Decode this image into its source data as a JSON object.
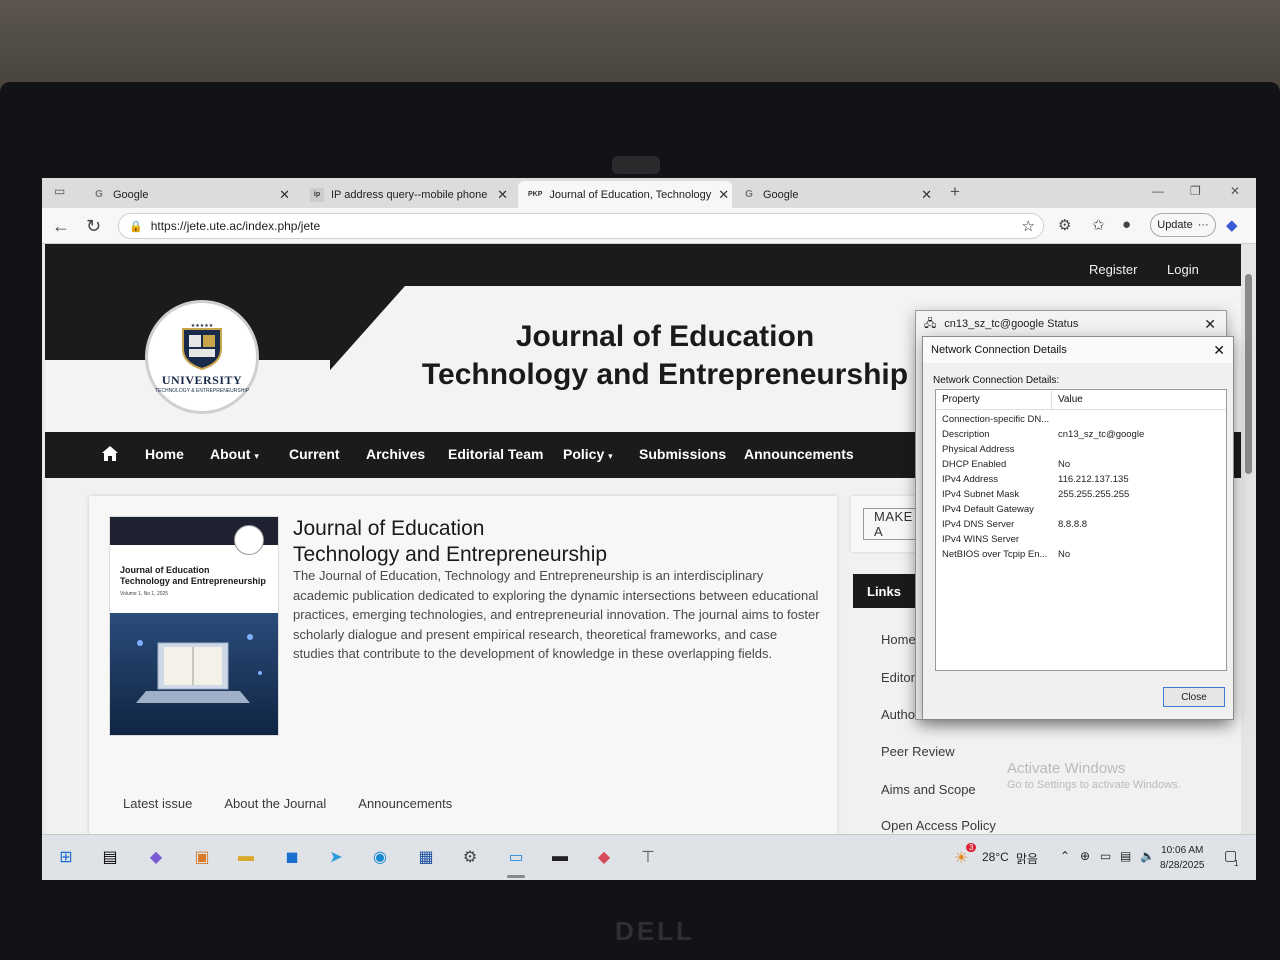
{
  "browser": {
    "tabs": [
      {
        "title": "Google",
        "favicon": "G"
      },
      {
        "title": "IP address query--mobile phone",
        "favicon": "ip"
      },
      {
        "title": "Journal of Education, Technology",
        "favicon": "PKP"
      },
      {
        "title": "Google",
        "favicon": "G"
      }
    ],
    "new_tab_symbol": "+",
    "url": "https://jete.ute.ac/index.php/jete",
    "update_label": "Update",
    "more_label": "···"
  },
  "site": {
    "top_links": {
      "register": "Register",
      "login": "Login"
    },
    "logo": {
      "name": "UNIVERSITY",
      "sub": "TECHNOLOGY & ENTREPRENEURSHIP"
    },
    "title_line1": "Journal of Education",
    "title_line2": "Technology and Entrepreneurship",
    "nav": {
      "home": "Home",
      "about": "About",
      "current": "Current",
      "archives": "Archives",
      "editorial_team": "Editorial Team",
      "policy": "Policy",
      "submissions": "Submissions",
      "announcements": "Announcements"
    }
  },
  "main": {
    "cover": {
      "title_line1": "Journal of Education",
      "title_line2": "Technology and Entrepreneurship",
      "volume": "Volume 1, No 1, 2025"
    },
    "heading_line1": "Journal of Education",
    "heading_line2": "Technology and Entrepreneurship",
    "description": "The Journal of Education, Technology and Entrepreneurship is an interdisciplinary academic publication dedicated to exploring the dynamic intersections between educational practices, emerging technologies, and entrepreneurial innovation. The journal aims to foster scholarly dialogue and present empirical research, theoretical frameworks, and case studies that contribute to the development of knowledge in these overlapping fields.",
    "tabs": [
      "Latest issue",
      "About the Journal",
      "Announcements"
    ]
  },
  "sidebar": {
    "make_button": "MAKE A",
    "links_heading": "Links",
    "links": [
      "Home",
      "Editori",
      "Author",
      "Peer Review",
      "Aims and Scope",
      "Open Access Policy"
    ]
  },
  "watermark": {
    "line1": "Activate Windows",
    "line2": "Go to Settings to activate Windows."
  },
  "status_window": {
    "title": "cn13_sz_tc@google Status"
  },
  "details_window": {
    "title": "Network Connection Details",
    "label": "Network Connection Details:",
    "columns": [
      "Property",
      "Value"
    ],
    "rows": [
      {
        "property": "Connection-specific DN...",
        "value": ""
      },
      {
        "property": "Description",
        "value": "cn13_sz_tc@google"
      },
      {
        "property": "Physical Address",
        "value": ""
      },
      {
        "property": "DHCP Enabled",
        "value": "No"
      },
      {
        "property": "IPv4 Address",
        "value": "116.212.137.135"
      },
      {
        "property": "IPv4 Subnet Mask",
        "value": "255.255.255.255"
      },
      {
        "property": "IPv4 Default Gateway",
        "value": ""
      },
      {
        "property": "IPv4 DNS Server",
        "value": "8.8.8.8"
      },
      {
        "property": "IPv4 WINS Server",
        "value": ""
      },
      {
        "property": "NetBIOS over Tcpip En...",
        "value": "No"
      }
    ],
    "close_label": "Close"
  },
  "taskbar": {
    "weather": "28°C",
    "weather_desc": "맑음",
    "weather_badge": "3",
    "time": "10:06 AM",
    "date": "8/28/2025",
    "notification_count": "1"
  },
  "brand": "DELL",
  "colors": {
    "nav_dark": "#1b1b1d",
    "page_bg": "#f1f1f0",
    "dialog_accent": "#3a7bd5"
  }
}
